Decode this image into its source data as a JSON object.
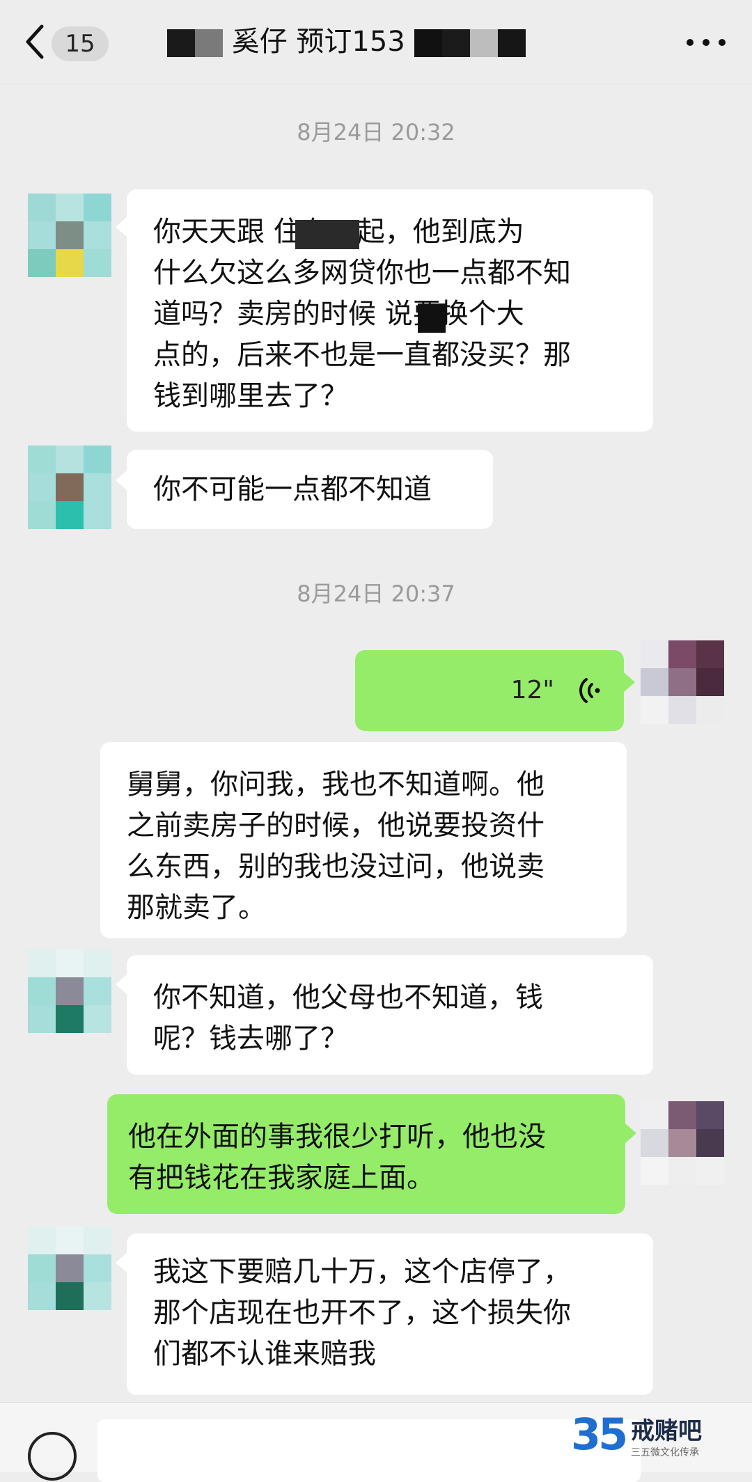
{
  "header": {
    "unread_count": "15",
    "title_visible": "奚仔 预订153",
    "back_icon": "chevron-left-icon",
    "more_icon": "more-dots-icon"
  },
  "timestamps": [
    "8月24日 20:32",
    "8月24日 20:37"
  ],
  "messages": [
    {
      "side": "left",
      "lines": [
        "你天天跟 住在一起，他到底为",
        "什么欠这么多网贷你也一点都不知",
        "道吗？卖房的时候 说要换个大",
        "点的，后来不也是一直都没买？那",
        "钱到哪里去了？"
      ]
    },
    {
      "side": "left",
      "lines": [
        "你不可能一点都不知道"
      ]
    },
    {
      "side": "right",
      "type": "voice",
      "duration": "12\"",
      "icon": "voice-wave-icon"
    },
    {
      "side": "left",
      "lines": [
        "舅舅，你问我，我也不知道啊。他",
        "之前卖房子的时候，他说要投资什",
        "么东西，别的我也没过问，他说卖",
        "那就卖了。"
      ]
    },
    {
      "side": "left",
      "lines": [
        "你不知道，他父母也不知道，钱",
        "呢？钱去哪了？"
      ]
    },
    {
      "side": "right",
      "lines": [
        "他在外面的事我很少打听，他也没",
        "有把钱花在我家庭上面。"
      ]
    },
    {
      "side": "left",
      "lines": [
        "我这下要赔几十万，这个店停了，",
        "那个店现在也开不了，这个损失你",
        "们都不认谁来赔我"
      ]
    }
  ],
  "bottom_bar": {
    "voice_icon": "voice-input-icon"
  },
  "watermark": {
    "number": "35",
    "name": "戒赌吧",
    "sub": "三五微文化传承"
  },
  "colors": {
    "background": "#ededed",
    "bubble_left": "#ffffff",
    "bubble_right": "#95ec69"
  }
}
